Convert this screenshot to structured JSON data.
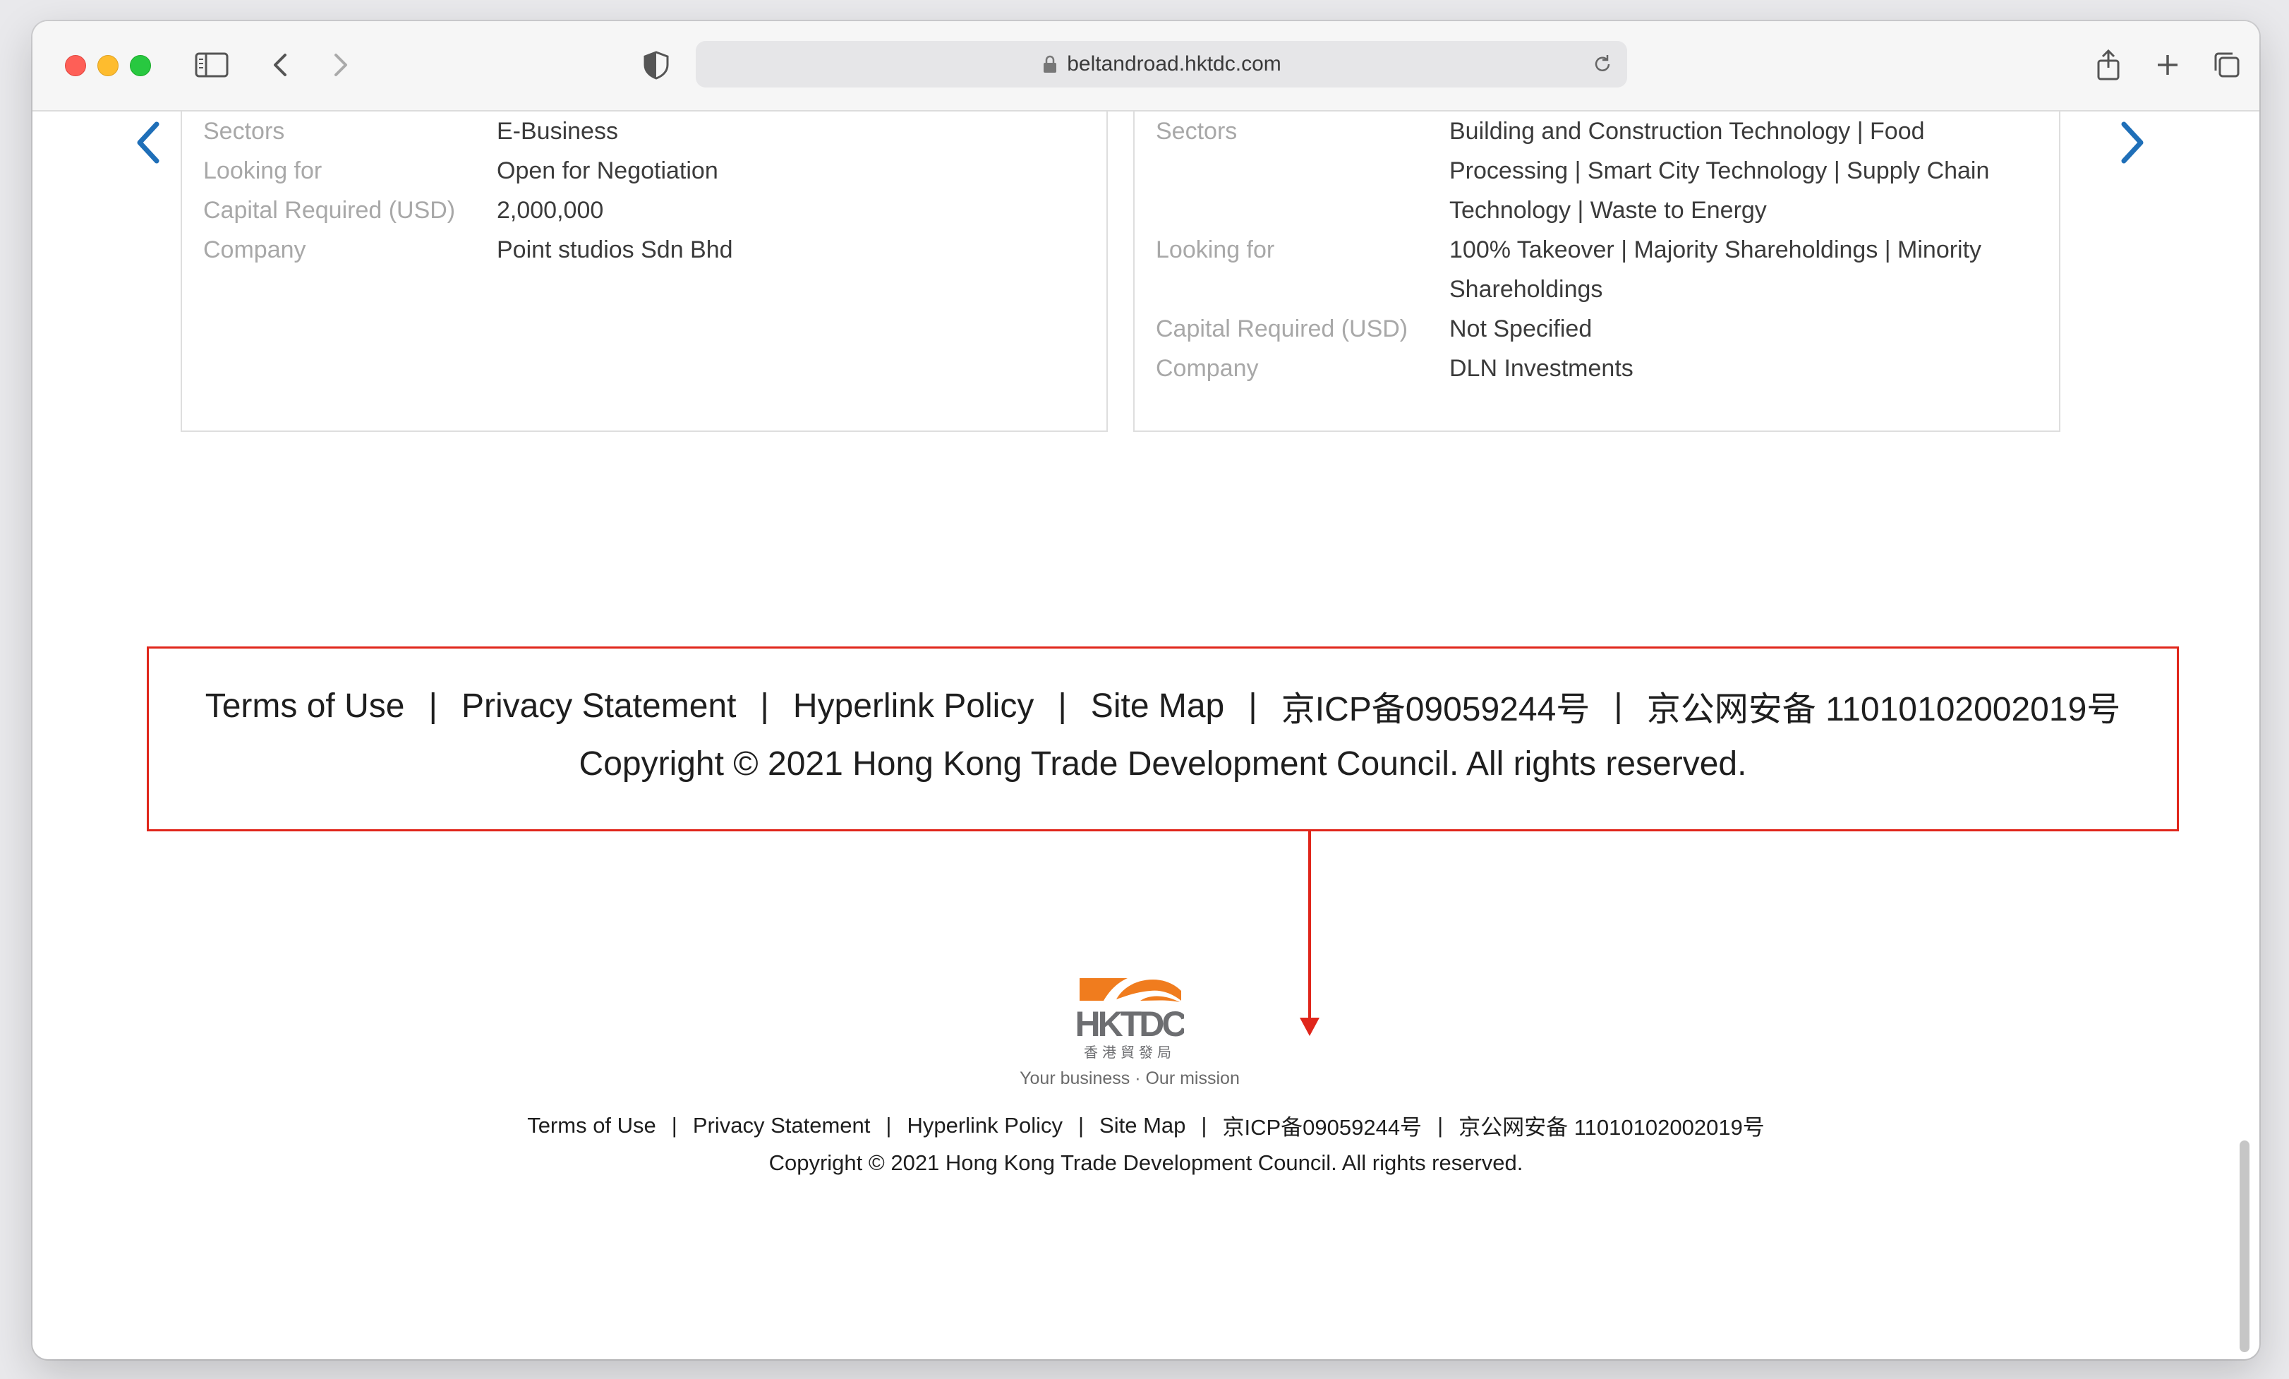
{
  "browser": {
    "url": "beltandroad.hktdc.com"
  },
  "cards": [
    {
      "rows": [
        {
          "label": "Sectors",
          "value": "E-Business"
        },
        {
          "label": "Looking for",
          "value": "Open for Negotiation"
        },
        {
          "label": "Capital Required (USD)",
          "value": "2,000,000"
        },
        {
          "label": "Company",
          "value": "Point studios Sdn Bhd"
        }
      ]
    },
    {
      "rows": [
        {
          "label": "Sectors",
          "value_lines": [
            "Building and Construction Technology | Food",
            "Processing | Smart City Technology | Supply Chain",
            "Technology | Waste to Energy"
          ]
        },
        {
          "label": "Looking for",
          "value_lines": [
            "100% Takeover | Majority Shareholdings | Minority",
            "Shareholdings"
          ]
        },
        {
          "label": "Capital Required (USD)",
          "value": "Not Specified"
        },
        {
          "label": "Company",
          "value": "DLN Investments"
        }
      ]
    }
  ],
  "footer": {
    "links": [
      "Terms of Use",
      "Privacy Statement",
      "Hyperlink Policy",
      "Site Map",
      "京ICP备09059244号",
      "京公网安备 11010102002019号"
    ],
    "separator": "|",
    "copyright": "Copyright © 2021  Hong Kong Trade Development Council. All rights reserved.",
    "logo_text": "HKTDC",
    "logo_chinese": "香港貿發局",
    "tagline": "Your business · Our mission"
  },
  "colors": {
    "accent_blue": "#1f6fb8",
    "annotation_red": "#e0261b",
    "logo_orange": "#f07c1e",
    "logo_gray": "#6d6e71"
  },
  "icons": [
    "sidebar-icon",
    "back-icon",
    "forward-icon",
    "shield-icon",
    "lock-icon",
    "reload-icon",
    "share-icon",
    "new-tab-icon",
    "tabs-overview-icon",
    "chevron-left-icon",
    "chevron-right-icon"
  ]
}
